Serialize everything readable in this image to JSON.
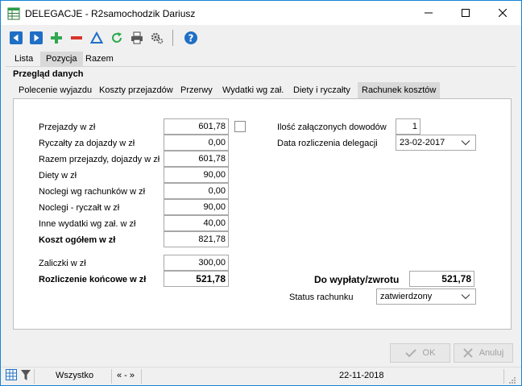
{
  "window": {
    "title": "DELEGACJE - R2samochodzik Dariusz"
  },
  "toolbar": {
    "icons": [
      "prev-arrow-icon",
      "next-arrow-icon",
      "add-icon",
      "delete-icon",
      "filter-triangle-icon",
      "refresh-icon",
      "print-icon",
      "settings-icon",
      "help-icon"
    ]
  },
  "tabs": {
    "top": [
      {
        "label": "Lista"
      },
      {
        "label": "Pozycja"
      },
      {
        "label": "Razem"
      }
    ],
    "active_top": "Pozycja"
  },
  "group": {
    "title": "Przegląd danych"
  },
  "subtabs": [
    {
      "label": "Polecenie wyjazdu"
    },
    {
      "label": "Koszty przejazdów"
    },
    {
      "label": "Przerwy"
    },
    {
      "label": "Wydatki wg zał."
    },
    {
      "label": "Diety i ryczałty"
    },
    {
      "label": "Rachunek kosztów"
    }
  ],
  "costs": {
    "przejazdy": {
      "label": "Przejazdy w zł",
      "value": "601,78"
    },
    "ryczalty": {
      "label": "Ryczałty za dojazdy w zł",
      "value": "0,00"
    },
    "razem": {
      "label": "Razem przejazdy, dojazdy w zł",
      "value": "601,78"
    },
    "diety": {
      "label": "Diety w zł",
      "value": "90,00"
    },
    "noclegi_rach": {
      "label": "Noclegi wg rachunków w zł",
      "value": "0,00"
    },
    "noclegi_rycz": {
      "label": "Noclegi - ryczałt w zł",
      "value": "90,00"
    },
    "inne": {
      "label": "Inne wydatki wg zał. w zł",
      "value": "40,00"
    },
    "koszt_ogolem": {
      "label": "Koszt ogółem w zł",
      "value": "821,78"
    },
    "zaliczki": {
      "label": "Zaliczki w zł",
      "value": "300,00"
    },
    "rozliczenie": {
      "label": "Rozliczenie końcowe w zł",
      "value": "521,78"
    }
  },
  "right": {
    "ilosc": {
      "label": "Ilość załączonych dowodów",
      "value": "1"
    },
    "data_rozl": {
      "label": "Data rozliczenia delegacji",
      "value": "23-02-2017"
    },
    "do_wyplaty": {
      "label": "Do wypłaty/zwrotu",
      "value": "521,78"
    },
    "status": {
      "label": "Status rachunku",
      "value": "zatwierdzony"
    }
  },
  "buttons": {
    "ok": "OK",
    "cancel": "Anuluj"
  },
  "statusbar": {
    "filter": "Wszystko",
    "nav": "« - »",
    "date": "22-11-2018"
  },
  "colors": {
    "accent_blue": "#1f6fc5",
    "add_green": "#2fa84f",
    "delete_red": "#d9332b",
    "border_blue": "#1883d7"
  }
}
